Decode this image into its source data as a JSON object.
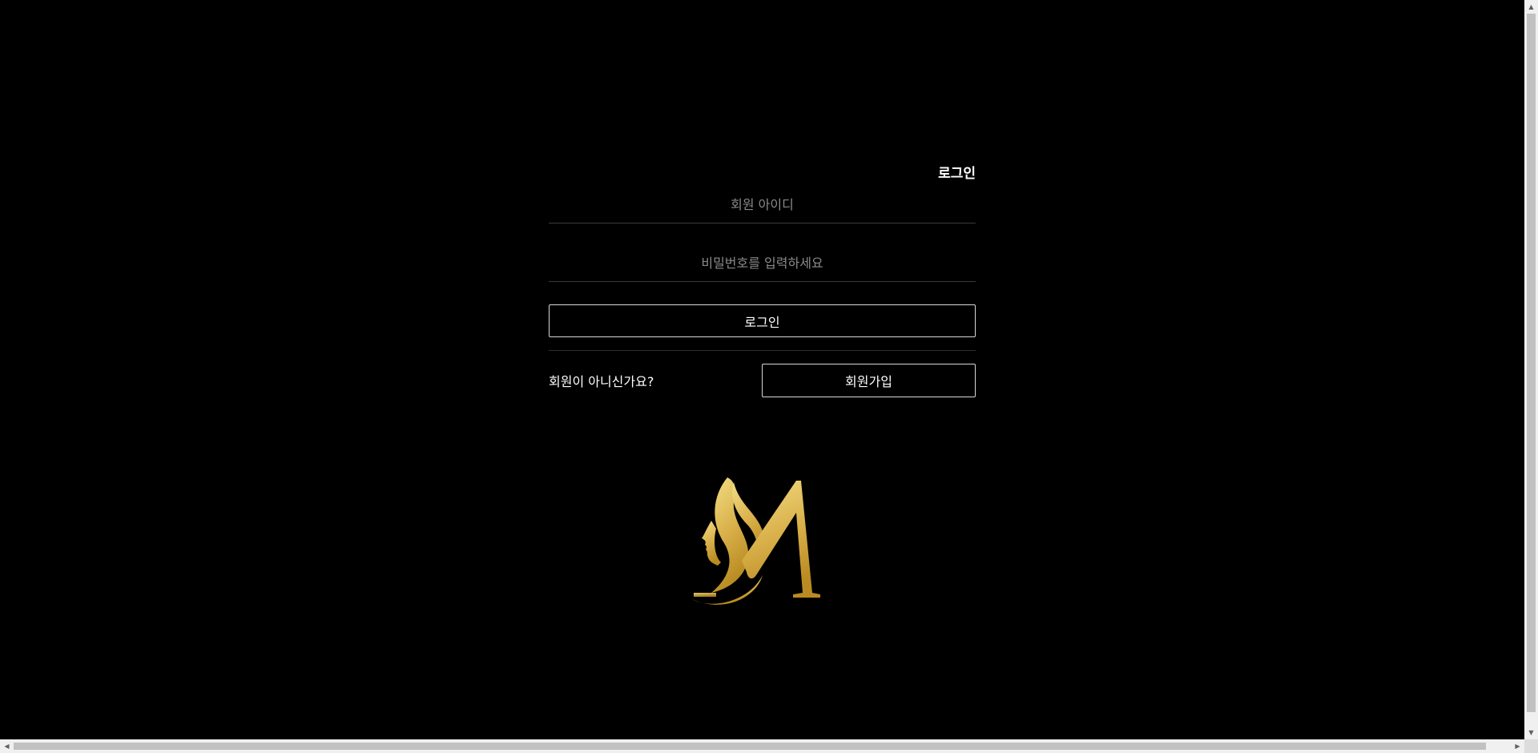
{
  "login": {
    "title": "로그인",
    "id_placeholder": "회원 아이디",
    "id_value": "",
    "password_placeholder": "비밀번호를 입력하세요",
    "password_value": "",
    "submit_label": "로그인"
  },
  "signup": {
    "prompt": "회원이 아니신가요?",
    "button_label": "회원가입"
  },
  "logo": {
    "icon": "m-woman-profile-logo",
    "colors": {
      "gold_light": "#f3de84",
      "gold_dark": "#b98b22"
    }
  },
  "theme": {
    "background": "#000000",
    "text": "#ffffff",
    "placeholder": "#8a8a8a",
    "border": "#d8d8d8"
  }
}
